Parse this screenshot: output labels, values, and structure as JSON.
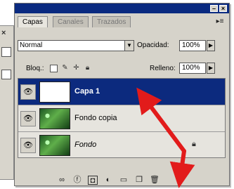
{
  "tabs": [
    "Capas",
    "Canales",
    "Trazados"
  ],
  "blend_mode": "Normal",
  "opacity": {
    "label": "Opacidad:",
    "value": "100%"
  },
  "lock": {
    "label": "Bloq.:"
  },
  "fill": {
    "label": "Relleno:",
    "value": "100%"
  },
  "layers": [
    {
      "name": "Capa 1",
      "selected": true
    },
    {
      "name": "Fondo copia",
      "selected": false
    },
    {
      "name": "Fondo",
      "selected": false,
      "locked": true
    }
  ],
  "colors": {
    "title_bar": "#0a2a80",
    "selection": "#0c2a7e",
    "annotation_arrow": "#e21b1b",
    "panel_bg": "#d6d3ca"
  },
  "icons": {
    "window_buttons": [
      "minimize-icon",
      "close-icon"
    ],
    "lock_options": [
      "lock-transparency-icon",
      "lock-paint-icon",
      "lock-move-icon",
      "lock-all-icon"
    ],
    "toolbar": [
      "link-layers-icon",
      "layer-style-icon",
      "layer-mask-icon",
      "adjustment-layer-icon",
      "new-group-icon",
      "new-layer-icon",
      "delete-layer-icon"
    ]
  }
}
